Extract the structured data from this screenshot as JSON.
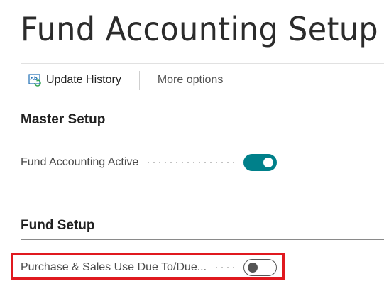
{
  "page": {
    "title": "Fund Accounting Setup"
  },
  "actions": {
    "update_history_label": "Update History",
    "update_history_icon": "update-history-icon",
    "more_options_label": "More options"
  },
  "sections": [
    {
      "title": "Master Setup",
      "fields": [
        {
          "label": "Fund Accounting Active",
          "value": true
        }
      ]
    },
    {
      "title": "Fund Setup",
      "fields": [
        {
          "label": "Purchase & Sales Use Due To/Due...",
          "value": false,
          "highlighted": true
        }
      ]
    }
  ],
  "colors": {
    "toggle_on": "#00808a",
    "highlight": "#e0191f",
    "icon_blue": "#1f6fb5",
    "icon_green": "#3aa657"
  }
}
